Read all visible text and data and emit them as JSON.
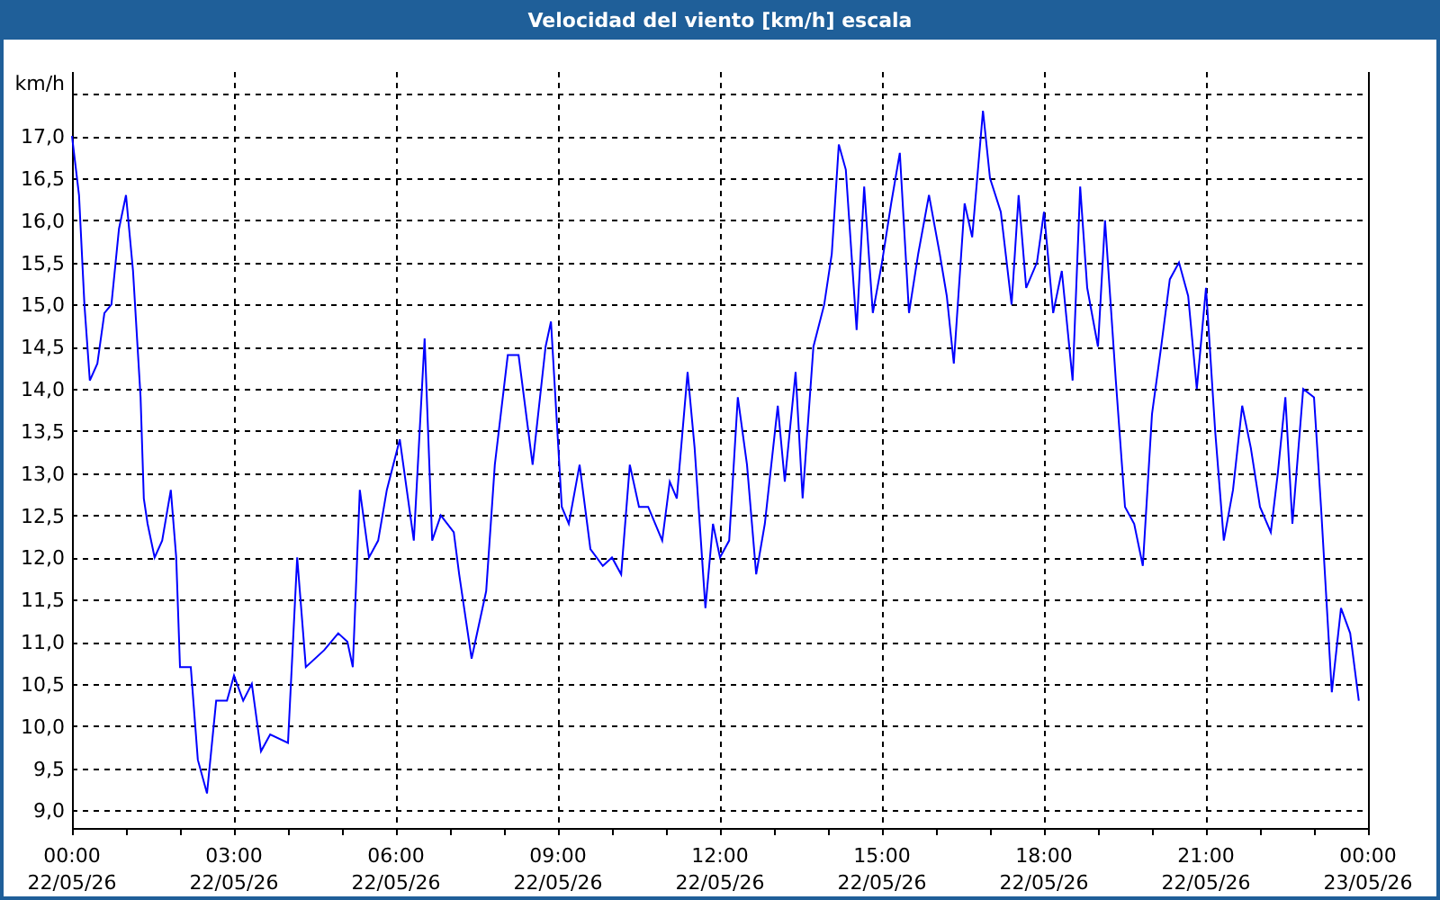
{
  "window": {
    "title": "Velocidad del viento [km/h] escala"
  },
  "chart": {
    "chart_data": {
      "type": "line",
      "ylabel": "km/h",
      "x": [
        0,
        0.13,
        0.23,
        0.33,
        0.47,
        0.6,
        0.73,
        0.87,
        1,
        1.13,
        1.27,
        1.33,
        1.4,
        1.53,
        1.67,
        1.83,
        1.93,
        2,
        2.13,
        2.2,
        2.33,
        2.5,
        2.67,
        2.87,
        3,
        3.17,
        3.33,
        3.5,
        3.67,
        4,
        4.17,
        4.33,
        4.67,
        4.93,
        5.1,
        5.2,
        5.33,
        5.5,
        5.67,
        5.83,
        6.07,
        6.33,
        6.53,
        6.67,
        6.83,
        7.07,
        7.17,
        7.4,
        7.67,
        7.83,
        8.07,
        8.27,
        8.53,
        8.77,
        8.87,
        9.07,
        9.2,
        9.4,
        9.6,
        9.83,
        10,
        10.17,
        10.33,
        10.5,
        10.67,
        10.93,
        11.07,
        11.2,
        11.4,
        11.53,
        11.73,
        11.87,
        12,
        12.17,
        12.33,
        12.5,
        12.67,
        12.83,
        13.07,
        13.2,
        13.4,
        13.53,
        13.73,
        13.93,
        14.07,
        14.2,
        14.33,
        14.53,
        14.67,
        14.83,
        15,
        15.17,
        15.33,
        15.5,
        15.67,
        15.87,
        16.07,
        16.2,
        16.33,
        16.53,
        16.67,
        16.87,
        17,
        17.2,
        17.4,
        17.53,
        17.67,
        17.87,
        18,
        18.17,
        18.33,
        18.53,
        18.67,
        18.8,
        19,
        19.13,
        19.33,
        19.5,
        19.67,
        19.83,
        20,
        20.17,
        20.33,
        20.5,
        20.67,
        20.83,
        21,
        21.17,
        21.33,
        21.5,
        21.67,
        21.83,
        22,
        22.2,
        22.33,
        22.47,
        22.6,
        22.8,
        23,
        23.13,
        23.33,
        23.5,
        23.67,
        23.83
      ],
      "series": [
        {
          "color": "#0000ff",
          "values": [
            17.0,
            16.3,
            15.0,
            14.1,
            14.3,
            14.9,
            15.0,
            15.9,
            16.3,
            15.4,
            13.9,
            12.7,
            12.4,
            12.0,
            12.2,
            12.8,
            12.0,
            10.7,
            10.7,
            10.7,
            9.6,
            9.2,
            10.3,
            10.3,
            10.6,
            10.3,
            10.5,
            9.7,
            9.9,
            9.8,
            12.0,
            10.7,
            10.9,
            11.1,
            11.0,
            10.7,
            12.8,
            12.0,
            12.2,
            12.8,
            13.4,
            12.2,
            14.6,
            12.2,
            12.5,
            12.3,
            11.8,
            10.8,
            11.6,
            13.1,
            14.4,
            14.4,
            13.1,
            14.5,
            14.8,
            12.6,
            12.4,
            13.1,
            12.1,
            11.9,
            12.0,
            11.8,
            13.1,
            12.6,
            12.6,
            12.2,
            12.9,
            12.7,
            14.2,
            13.3,
            11.4,
            12.4,
            12.0,
            12.2,
            13.9,
            13.1,
            11.8,
            12.4,
            13.8,
            12.9,
            14.2,
            12.7,
            14.5,
            15.0,
            15.6,
            16.9,
            16.6,
            14.7,
            16.4,
            14.9,
            15.5,
            16.2,
            16.8,
            14.9,
            15.6,
            16.3,
            15.6,
            15.1,
            14.3,
            16.2,
            15.8,
            17.3,
            16.5,
            16.1,
            15.0,
            16.3,
            15.2,
            15.5,
            16.1,
            14.9,
            15.4,
            14.1,
            16.4,
            15.2,
            14.5,
            16.0,
            14.1,
            12.6,
            12.4,
            11.9,
            13.7,
            14.5,
            15.3,
            15.5,
            15.1,
            14.0,
            15.2,
            13.5,
            12.2,
            12.8,
            13.8,
            13.3,
            12.6,
            12.3,
            13.0,
            13.9,
            12.4,
            14.0,
            13.9,
            12.6,
            10.4,
            11.4,
            11.1,
            10.3
          ]
        }
      ],
      "grid": true,
      "xlim": [
        0,
        24
      ],
      "ylim": [
        8.79,
        17.76
      ],
      "xticks": [
        {
          "value": 0,
          "label": "00:00"
        },
        {
          "value": 3,
          "label": "03:00"
        },
        {
          "value": 6,
          "label": "06:00"
        },
        {
          "value": 9,
          "label": "09:00"
        },
        {
          "value": 12,
          "label": "12:00"
        },
        {
          "value": 15,
          "label": "15:00"
        },
        {
          "value": 18,
          "label": "18:00"
        },
        {
          "value": 21,
          "label": "21:00"
        },
        {
          "value": 24,
          "label": "00:00"
        }
      ],
      "yticks": [
        {
          "value": 9,
          "label": "9,0"
        },
        {
          "value": 9.5,
          "label": "9,5"
        },
        {
          "value": 10,
          "label": "10,0"
        },
        {
          "value": 10.5,
          "label": "10,5"
        },
        {
          "value": 11,
          "label": "11,0"
        },
        {
          "value": 11.5,
          "label": "11,5"
        },
        {
          "value": 12,
          "label": "12,0"
        },
        {
          "value": 12.5,
          "label": "12,5"
        },
        {
          "value": 13,
          "label": "13,0"
        },
        {
          "value": 13.5,
          "label": "13,5"
        },
        {
          "value": 14,
          "label": "14,0"
        },
        {
          "value": 14.5,
          "label": "14,5"
        },
        {
          "value": 15,
          "label": "15,0"
        },
        {
          "value": 15.5,
          "label": "15,5"
        },
        {
          "value": 16,
          "label": "16,0"
        },
        {
          "value": 16.5,
          "label": "16,5"
        },
        {
          "value": 17,
          "label": "17,0"
        }
      ]
    },
    "x_dates": [
      "22/05/26",
      "22/05/26",
      "22/05/26",
      "22/05/26",
      "22/05/26",
      "22/05/26",
      "22/05/26",
      "22/05/26",
      "23/05/26"
    ]
  }
}
